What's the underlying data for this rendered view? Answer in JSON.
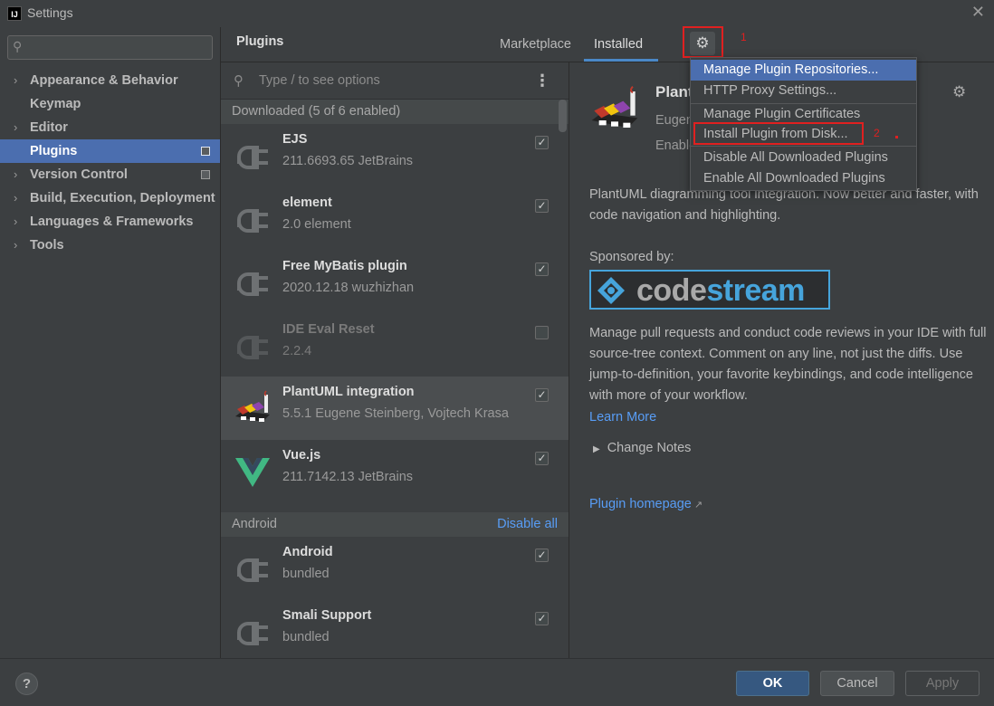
{
  "window": {
    "title": "Settings",
    "app_icon": "IJ"
  },
  "sidebar": {
    "search_placeholder": "",
    "items": [
      {
        "label": "Appearance & Behavior",
        "expandable": true
      },
      {
        "label": "Keymap",
        "expandable": false
      },
      {
        "label": "Editor",
        "expandable": true
      },
      {
        "label": "Plugins",
        "expandable": false,
        "selected": true
      },
      {
        "label": "Version Control",
        "expandable": true
      },
      {
        "label": "Build, Execution, Deployment",
        "expandable": true
      },
      {
        "label": "Languages & Frameworks",
        "expandable": true
      },
      {
        "label": "Tools",
        "expandable": true
      }
    ]
  },
  "header": {
    "title": "Plugins",
    "tabs": [
      {
        "label": "Marketplace"
      },
      {
        "label": "Installed",
        "active": true
      }
    ]
  },
  "annotations": {
    "step1": "1",
    "step2": "2"
  },
  "list": {
    "search_placeholder": "Type / to see options",
    "groups": [
      {
        "header": "Downloaded (5 of 6 enabled)",
        "plugins": [
          {
            "name": "EJS",
            "meta": "211.6693.65  JetBrains",
            "checked": true
          },
          {
            "name": "element",
            "meta": "2.0  element",
            "checked": true
          },
          {
            "name": "Free MyBatis plugin",
            "meta": "2020.12.18  wuzhizhan",
            "checked": true
          },
          {
            "name": "IDE Eval Reset",
            "meta": "2.2.4",
            "checked": false
          },
          {
            "name": "PlantUML integration",
            "meta": "5.5.1  Eugene Steinberg, Vojtech Krasa",
            "checked": true
          },
          {
            "name": "Vue.js",
            "meta": "211.7142.13  JetBrains",
            "checked": true
          }
        ]
      },
      {
        "header": "Android",
        "action": "Disable all",
        "plugins": [
          {
            "name": "Android",
            "meta": "bundled",
            "checked": true
          },
          {
            "name": "Smali Support",
            "meta": "bundled",
            "checked": true
          }
        ]
      }
    ]
  },
  "details": {
    "title": "Plant",
    "vendor": "Eugene",
    "enable": "Enable",
    "description": "PlantUML diagramming tool integration. Now better and faster, with code navigation and highlighting.",
    "sponsored_label": "Sponsored by:",
    "sponsor_word_1": "code",
    "sponsor_word_2": "stream",
    "long_description": "Manage pull requests and conduct code reviews in your IDE with full source-tree context. Comment on any line, not just the diffs. Use jump-to-definition, your favorite keybindings, and code intelligence with more of your workflow.",
    "learn_more": "Learn More",
    "change_notes": "Change Notes",
    "homepage": "Plugin homepage"
  },
  "gear_menu": {
    "items": [
      "Manage Plugin Repositories...",
      "HTTP Proxy Settings...",
      "Manage Plugin Certificates",
      "Install Plugin from Disk...",
      "Disable All Downloaded Plugins",
      "Enable All Downloaded Plugins"
    ]
  },
  "footer": {
    "help": "?",
    "ok": "OK",
    "cancel": "Cancel",
    "apply": "Apply"
  },
  "colors": {
    "selection": "#4b6eaf",
    "link": "#589df6",
    "annotation": "#e02020",
    "ok_button": "#365880"
  }
}
